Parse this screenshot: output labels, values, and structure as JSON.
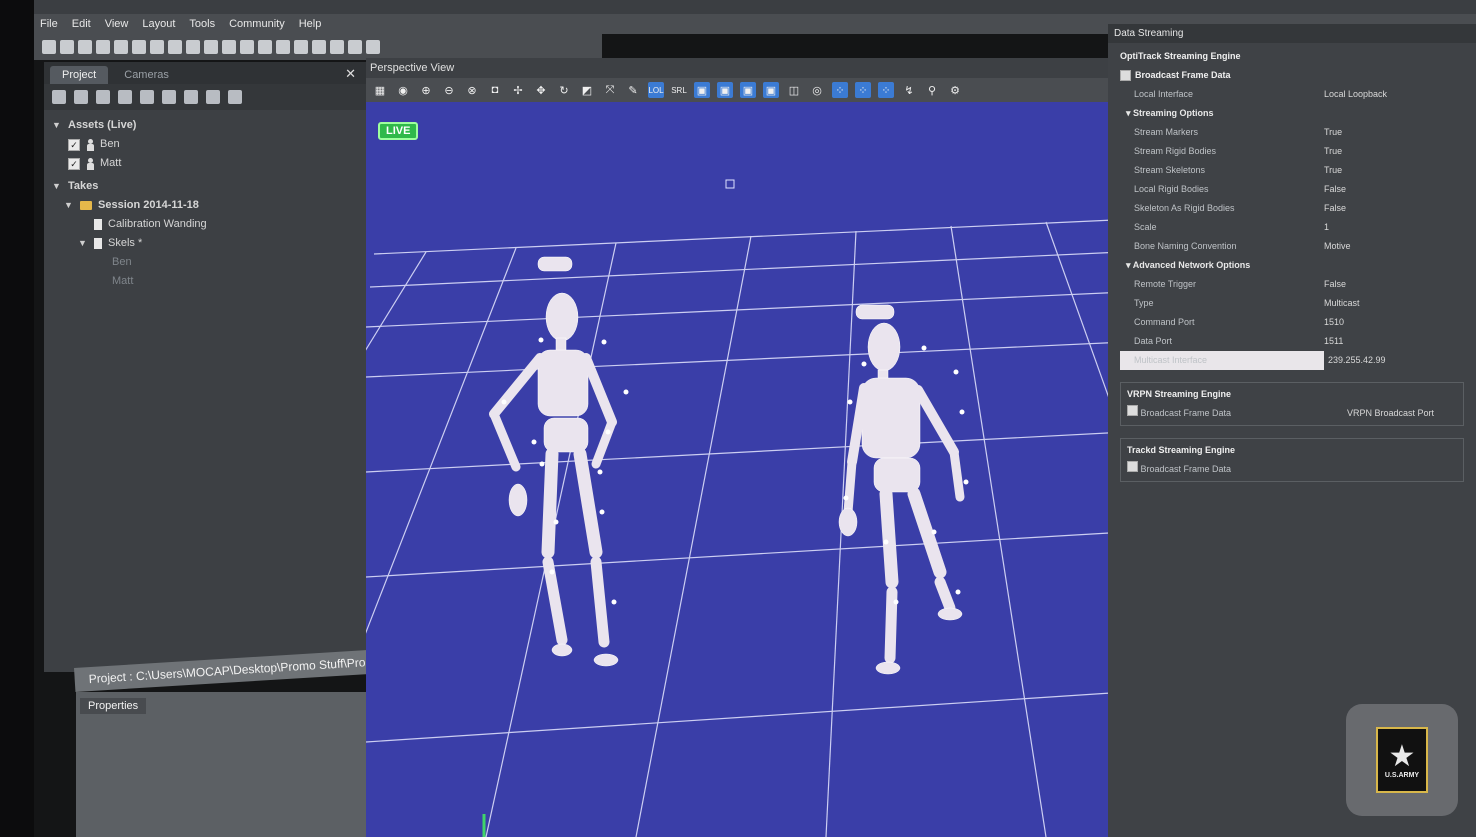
{
  "menu": [
    "File",
    "Edit",
    "View",
    "Layout",
    "Tools",
    "Community",
    "Help"
  ],
  "project_panel": {
    "tabs": [
      "Project",
      "Cameras"
    ],
    "assets_header": "Assets (Live)",
    "assets": [
      "Ben",
      "Matt"
    ],
    "takes_header": "Takes",
    "session": "Session 2014-11-18",
    "items": [
      "Calibration Wanding",
      "Skels *"
    ],
    "skels_children": [
      "Ben",
      "Matt"
    ]
  },
  "project_path": "Project : C:\\Users\\MOCAP\\Desktop\\Promo Stuff\\Promo.ttp",
  "properties_tab": "Properties",
  "perspective": {
    "title": "Perspective View",
    "live_label": "LIVE",
    "toolbar_labels": [
      "LOL",
      "SRL"
    ]
  },
  "data_streaming": {
    "title": "Data Streaming",
    "engine": "OptiTrack Streaming Engine",
    "broadcast": "Broadcast Frame Data",
    "local_interface": {
      "label": "Local Interface",
      "value": "Local Loopback"
    },
    "streaming_options_header": "Streaming Options",
    "streaming_options": [
      {
        "label": "Stream Markers",
        "value": "True"
      },
      {
        "label": "Stream Rigid Bodies",
        "value": "True"
      },
      {
        "label": "Stream Skeletons",
        "value": "True"
      },
      {
        "label": "Local Rigid Bodies",
        "value": "False"
      },
      {
        "label": "Skeleton As Rigid Bodies",
        "value": "False"
      },
      {
        "label": "Scale",
        "value": "1"
      },
      {
        "label": "Bone Naming Convention",
        "value": "Motive"
      }
    ],
    "advanced_header": "Advanced Network Options",
    "advanced": [
      {
        "label": "Remote Trigger",
        "value": "False"
      },
      {
        "label": "Type",
        "value": "Multicast"
      },
      {
        "label": "Command Port",
        "value": "1510"
      },
      {
        "label": "Data Port",
        "value": "1511"
      }
    ],
    "multicast_label": "Multicast Interface",
    "multicast_value": "239.255.42.99",
    "vrpn_engine": "VRPN Streaming Engine",
    "vrpn_broadcast": "Broadcast Frame Data",
    "vrpn_port_label": "VRPN Broadcast Port",
    "trackd_engine": "Trackd Streaming Engine",
    "trackd_broadcast": "Broadcast Frame Data"
  },
  "watermark": {
    "text": "U.S.ARMY"
  }
}
